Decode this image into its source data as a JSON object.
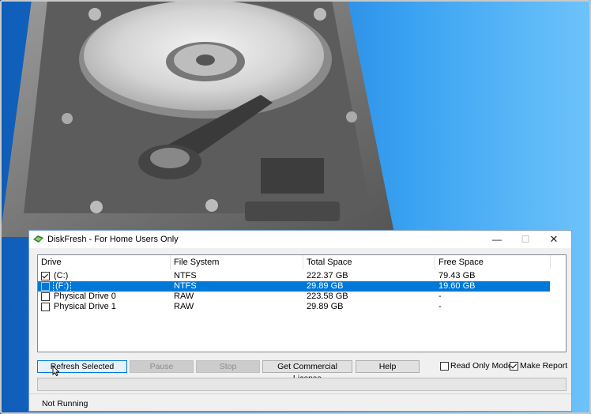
{
  "window": {
    "title": "DiskFresh - For Home Users Only"
  },
  "window_controls": {
    "minimize": "—",
    "maximize": "☐",
    "close": "✕"
  },
  "table": {
    "columns": [
      "Drive",
      "File System",
      "Total Space",
      "Free Space"
    ],
    "rows": [
      {
        "checked": true,
        "selected": false,
        "drive": "(C:)",
        "fs": "NTFS",
        "total": "222.37 GB",
        "free": "79.43 GB"
      },
      {
        "checked": false,
        "selected": true,
        "drive": "(F:)",
        "fs": "NTFS",
        "total": "29.89 GB",
        "free": "19.60 GB"
      },
      {
        "checked": false,
        "selected": false,
        "drive": "Physical Drive 0",
        "fs": "RAW",
        "total": "223.58 GB",
        "free": "-"
      },
      {
        "checked": false,
        "selected": false,
        "drive": "Physical Drive 1",
        "fs": "RAW",
        "total": "29.89 GB",
        "free": "-"
      }
    ]
  },
  "buttons": {
    "refresh": "Refresh Selected",
    "pause": "Pause",
    "stop": "Stop",
    "license": "Get Commercial License",
    "help": "Help"
  },
  "options": {
    "read_only": {
      "label": "Read Only Mode",
      "checked": false
    },
    "make_report": {
      "label": "Make Report",
      "checked": true
    }
  },
  "progress": {
    "value": 0
  },
  "status": {
    "text": "Not Running"
  },
  "colors": {
    "selection": "#0078d7",
    "desktop": "#1a78d8"
  }
}
